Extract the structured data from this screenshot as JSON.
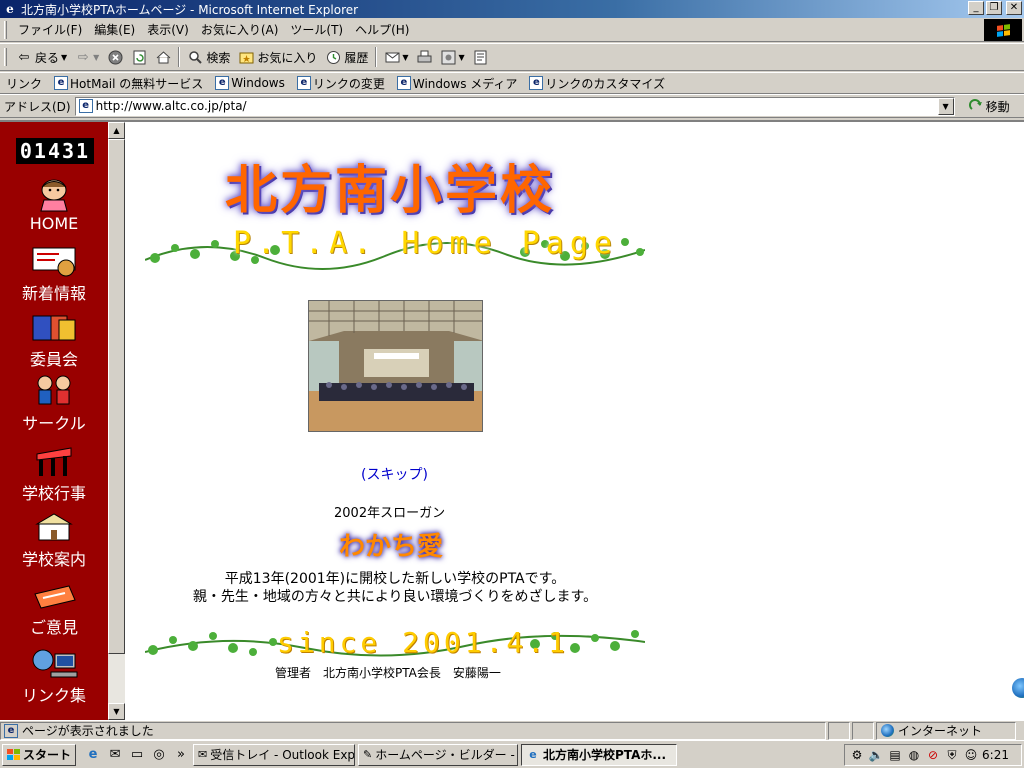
{
  "window": {
    "title": "北方南小学校PTAホームページ - Microsoft Internet Explorer"
  },
  "menu": [
    "ファイル(F)",
    "編集(E)",
    "表示(V)",
    "お気に入り(A)",
    "ツール(T)",
    "ヘルプ(H)"
  ],
  "toolbar": {
    "back": "戻る",
    "search": "検索",
    "favorites": "お気に入り",
    "history": "履歴"
  },
  "links": {
    "label": "リンク",
    "items": [
      "HotMail の無料サービス",
      "Windows",
      "リンクの変更",
      "Windows メディア",
      "リンクのカスタマイズ"
    ]
  },
  "address": {
    "label": "アドレス(D)",
    "url": "http://www.altc.co.jp/pta/",
    "go": "移動"
  },
  "sidebar": {
    "counter": "01431",
    "items": [
      {
        "label": "HOME",
        "icon": "home-character-icon"
      },
      {
        "label": "新着情報",
        "icon": "news-icon"
      },
      {
        "label": "委員会",
        "icon": "committee-icon"
      },
      {
        "label": "サークル",
        "icon": "circle-icon"
      },
      {
        "label": "学校行事",
        "icon": "school-events-icon"
      },
      {
        "label": "学校案内",
        "icon": "school-guide-icon"
      },
      {
        "label": "ご意見",
        "icon": "opinion-icon"
      },
      {
        "label": "リンク集",
        "icon": "links-computer-icon"
      }
    ]
  },
  "main": {
    "school_name": "北方南小学校",
    "pta_title": "P.T.A. Home Page",
    "skip": "(スキップ)",
    "slogan_year": "2002年スローガン",
    "slogan": "わかち愛",
    "desc_line1": "平成13年(2001年)に開校した新しい学校のPTAです。",
    "desc_line2": "親・先生・地域の方々と共により良い環境づくりをめざします。",
    "since": "since 2001.4.1",
    "admin": "管理者　北方南小学校PTA会長　安藤陽一"
  },
  "status": {
    "text": "ページが表示されました",
    "zone": "インターネット"
  },
  "taskbar": {
    "start": "スタート",
    "tasks": [
      "受信トレイ - Outlook Expr...",
      "ホームページ・ビルダー - [li...",
      "北方南小学校PTAホ..."
    ],
    "clock": "6:21"
  },
  "colors": {
    "sidebar_bg": "#990000",
    "title_orange": "#ff6600",
    "link_blue": "#0000cc"
  }
}
